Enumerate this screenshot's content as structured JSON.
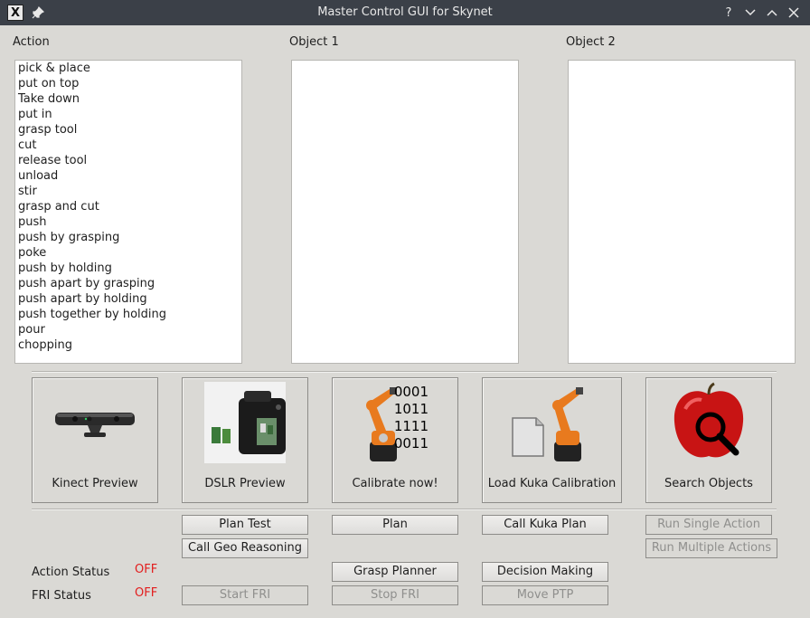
{
  "window": {
    "title": "Master Control GUI for Skynet",
    "app_icon_glyph": "X",
    "pin_glyph": "📌",
    "help_glyph": "?",
    "minimize_glyph": "∨",
    "maximize_glyph": "∧",
    "close_glyph": "✕"
  },
  "columns": {
    "action_label": "Action",
    "object1_label": "Object 1",
    "object2_label": "Object 2"
  },
  "actions": [
    "pick & place",
    "put on top",
    "Take down",
    "put in",
    "grasp tool",
    "cut",
    "release tool",
    "unload",
    "stir",
    "grasp and cut",
    "push",
    "push by grasping",
    "poke",
    "push by holding",
    "push apart by grasping",
    "push apart by holding",
    "push together by holding",
    "pour",
    "chopping"
  ],
  "image_buttons": {
    "kinect": "Kinect Preview",
    "dslr": "DSLR Preview",
    "calibrate": "Calibrate now!",
    "load_kuka": "Load Kuka Calibration",
    "search": "Search Objects"
  },
  "calib_digits": [
    "0001",
    "1011",
    "1111",
    "0011"
  ],
  "buttons": {
    "plan_test": "Plan Test",
    "plan": "Plan",
    "call_kuka_plan": "Call Kuka Plan",
    "run_single": "Run Single Action",
    "call_geo": "Call Geo Reasoning",
    "run_multiple": "Run Multiple Actions",
    "grasp_planner": "Grasp Planner",
    "decision_making": "Decision Making",
    "start_fri": "Start FRI",
    "stop_fri": "Stop FRI",
    "move_ptp": "Move PTP"
  },
  "status": {
    "action_label": "Action Status",
    "action_value": "OFF",
    "fri_label": "FRI Status",
    "fri_value": "OFF",
    "off_color": "#e21d1d"
  }
}
